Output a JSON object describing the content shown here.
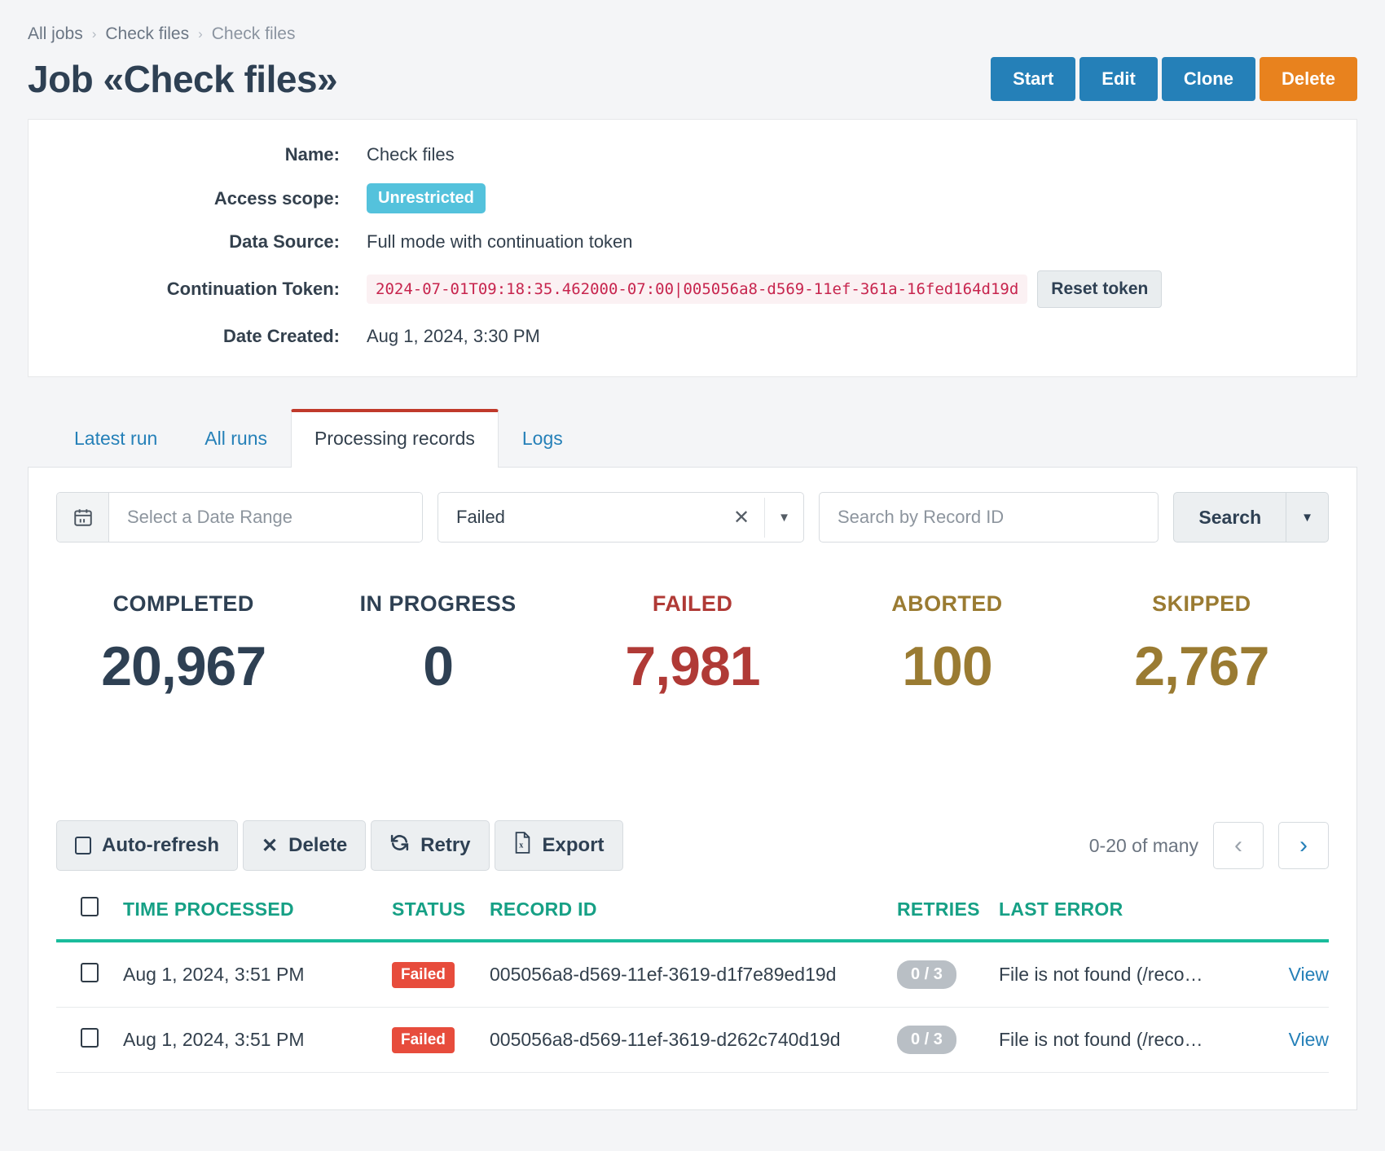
{
  "breadcrumb": {
    "items": [
      {
        "label": "All jobs",
        "current": false
      },
      {
        "label": "Check files",
        "current": false
      },
      {
        "label": "Check files",
        "current": true
      }
    ],
    "separator": "›"
  },
  "header": {
    "title": "Job «Check files»",
    "actions": [
      {
        "label": "Start",
        "style": "primary"
      },
      {
        "label": "Edit",
        "style": "primary"
      },
      {
        "label": "Clone",
        "style": "primary"
      },
      {
        "label": "Delete",
        "style": "danger"
      }
    ],
    "colors": {
      "primary": "#2580b8",
      "danger": "#e8821e"
    }
  },
  "info": {
    "name_label": "Name:",
    "name_value": "Check files",
    "access_scope_label": "Access scope:",
    "access_scope_value": "Unrestricted",
    "access_scope_color": "#54c2dc",
    "data_source_label": "Data Source:",
    "data_source_value": "Full mode with continuation token",
    "continuation_token_label": "Continuation Token:",
    "continuation_token_value": "2024-07-01T09:18:35.462000-07:00|005056a8-d569-11ef-361a-16fed164d19d",
    "reset_token_label": "Reset token",
    "date_created_label": "Date Created:",
    "date_created_value": "Aug 1, 2024, 3:30 PM"
  },
  "tabs": [
    {
      "label": "Latest run",
      "active": false
    },
    {
      "label": "All runs",
      "active": false
    },
    {
      "label": "Processing records",
      "active": true
    },
    {
      "label": "Logs",
      "active": false
    }
  ],
  "filters": {
    "date_range_placeholder": "Select a Date Range",
    "date_range_value": "",
    "calendar_icon": "calendar-icon",
    "status_value": "Failed",
    "status_clear_icon": "clear-icon",
    "status_caret_icon": "chevron-down-icon",
    "search_placeholder": "Search by Record ID",
    "search_value": "",
    "search_button_label": "Search",
    "search_caret_icon": "chevron-down-icon"
  },
  "stats": [
    {
      "label": "COMPLETED",
      "value": "20,967",
      "color": "#2e4053"
    },
    {
      "label": "IN PROGRESS",
      "value": "0",
      "color": "#2e4053"
    },
    {
      "label": "FAILED",
      "value": "7,981",
      "color": "#b03a36"
    },
    {
      "label": "ABORTED",
      "value": "100",
      "color": "#9a7b32"
    },
    {
      "label": "SKIPPED",
      "value": "2,767",
      "color": "#9a7b32"
    }
  ],
  "toolbar": {
    "auto_refresh_label": "Auto-refresh",
    "delete_label": "Delete",
    "delete_icon": "close-icon",
    "retry_label": "Retry",
    "retry_icon": "refresh-icon",
    "export_label": "Export",
    "export_icon": "excel-file-icon",
    "pagination_text": "0-20 of many",
    "prev_icon": "chevron-left-icon",
    "next_icon": "chevron-right-icon"
  },
  "table": {
    "columns": [
      "TIME PROCESSED",
      "STATUS",
      "RECORD ID",
      "RETRIES",
      "LAST ERROR"
    ],
    "view_label": "View",
    "rows": [
      {
        "time": "Aug 1, 2024, 3:51 PM",
        "status": "Failed",
        "record_id": "005056a8-d569-11ef-3619-d1f7e89ed19d",
        "retries": "0 / 3",
        "last_error": "File is not found (/reco…"
      },
      {
        "time": "Aug 1, 2024, 3:51 PM",
        "status": "Failed",
        "record_id": "005056a8-d569-11ef-3619-d262c740d19d",
        "retries": "0 / 3",
        "last_error": "File is not found (/reco…"
      }
    ]
  }
}
